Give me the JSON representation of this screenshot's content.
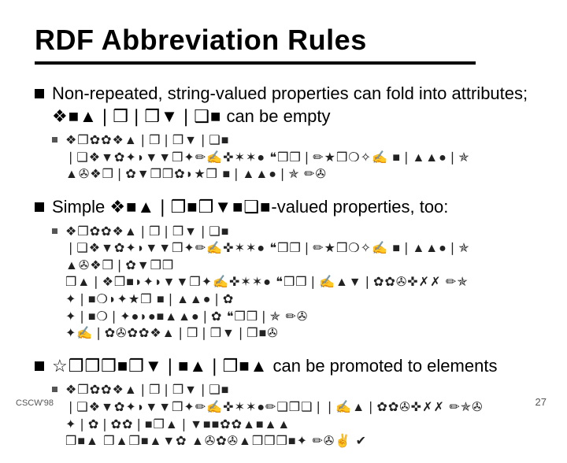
{
  "slide": {
    "title": "RDF Abbreviation Rules",
    "points": [
      {
        "head_pre": "Non-repeated, string-valued properties can fold into attributes; ",
        "head_ding": "❖■▲❘❒❘❒▼❘❑■",
        "head_post": " can be empty",
        "code": "❖❒✿✿❖▲❘❒❘❒▼❘❑■\n❘❑❖▼✿✦◗▼▼❒✦✏✍✜✶✶● ❝❒❒❘✏★❒❍✧✍ ■❘▲▲●❘✯\n▲✇❖❒❘✿▼❒❒✿◗★❒ ■❘▲▲●❘✯ ✏✇"
      },
      {
        "head_pre": "Simple ",
        "head_ding": "❖■▲❘❒■❒▼■❑■",
        "head_post": "-valued properties, too:",
        "code": "❖❒✿✿❖▲❘❒❘❒▼❘❑■\n❘❑❖▼✿✦◗▼▼❒✦✏✍✜✶✶● ❝❒❒❘✏★❒❍✧✍ ■❘▲▲●❘✯\n▲✇❖❒❘✿▼❒❒\n❒▲❘❖❒■◗✦◗▼▼❒✦✍✜✶✶● ❝❒❒❘✍▲▼❘✿✿✇✜✗✗ ✏✯\n✦❘■❍◗✦★❒ ■❘▲▲●❘✿\n✦❘■❍❘✦●◗●■▲▲●❘✿ ❝❒❒❘✯ ✏✇\n✦✍❘✿✇✿✿❖▲❘❒❘❒▼❘❒■✇"
      },
      {
        "head_pre": "",
        "head_ding": "☆❒❒❒■❒▼❘■▲❘❒■▲",
        "head_post": " can be promoted to elements",
        "code": "❖❒✿✿❖▲❘❒❘❒▼❘❑■\n❘❑❖▼✿✦◗▼▼❒✦✏✍✜✶✶●✏❑❒❑❘❘✍▲❘✿✿✇✜✗✗ ✏✯✇\n✦❘✿❘✿✿❘■❒▲❘▼■■✿✿▲■▲▲\n❒■▲ ❒▲❒■▲▼✿ ▲✇✿✇▲❒❒❒■✦ ✏✇✌ ✔"
      }
    ],
    "footer_left": "CSCW'98",
    "footer_right": "27"
  }
}
